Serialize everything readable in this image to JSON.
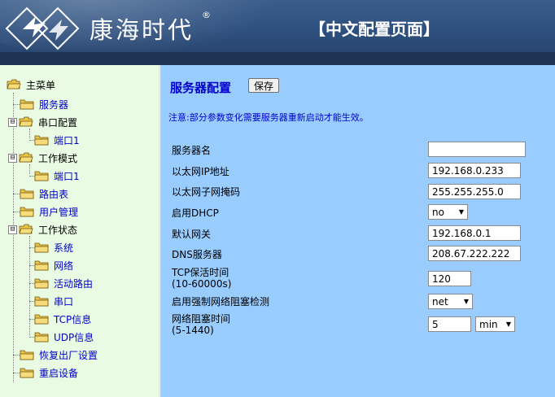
{
  "header": {
    "brand": "康海时代",
    "reg_mark": "®",
    "page_title": "【中文配置页面】",
    "colors": {
      "band": "#2f5180",
      "bottom": "#1e3454"
    }
  },
  "sidebar": {
    "root": "主菜单",
    "items": [
      {
        "label": "服务器"
      },
      {
        "label": "串口配置"
      },
      {
        "label": "端口1"
      },
      {
        "label": "工作模式"
      },
      {
        "label": "端口1"
      },
      {
        "label": "路由表"
      },
      {
        "label": "用户管理"
      },
      {
        "label": "工作状态"
      },
      {
        "label": "系统"
      },
      {
        "label": "网络"
      },
      {
        "label": "活动路由"
      },
      {
        "label": "串口"
      },
      {
        "label": "TCP信息"
      },
      {
        "label": "UDP信息"
      },
      {
        "label": "恢复出厂设置"
      },
      {
        "label": "重启设备"
      }
    ],
    "toggle_symbol": "⊟",
    "colors": {
      "background": "#e9fbe2",
      "folder": "#e8c44a"
    }
  },
  "main": {
    "title": "服务器配置",
    "save_label": "保存",
    "notice": "注意:部分参数变化需要服务器重新启动才能生效。",
    "fields": {
      "server_name": {
        "label": "服务器名",
        "value": ""
      },
      "ip": {
        "label": "以太网IP地址",
        "value": "192.168.0.233"
      },
      "mask": {
        "label": "以太网子网掩码",
        "value": "255.255.255.0"
      },
      "dhcp": {
        "label": "启用DHCP",
        "value": "no"
      },
      "gateway": {
        "label": "默认网关",
        "value": "192.168.0.1"
      },
      "dns": {
        "label": "DNS服务器",
        "value": "208.67.222.222"
      },
      "keepalive": {
        "label_line1": "TCP保活时间",
        "label_line2": "(10-60000s)",
        "value": "120"
      },
      "block_detect": {
        "label": "启用强制网络阻塞检测",
        "value": "net"
      },
      "block_time": {
        "label_line1": "网络阻塞时间",
        "label_line2": "(5-1440)",
        "value": "5",
        "unit": "min"
      }
    },
    "colors": {
      "background": "#99ccff",
      "title": "#0000cc"
    }
  }
}
